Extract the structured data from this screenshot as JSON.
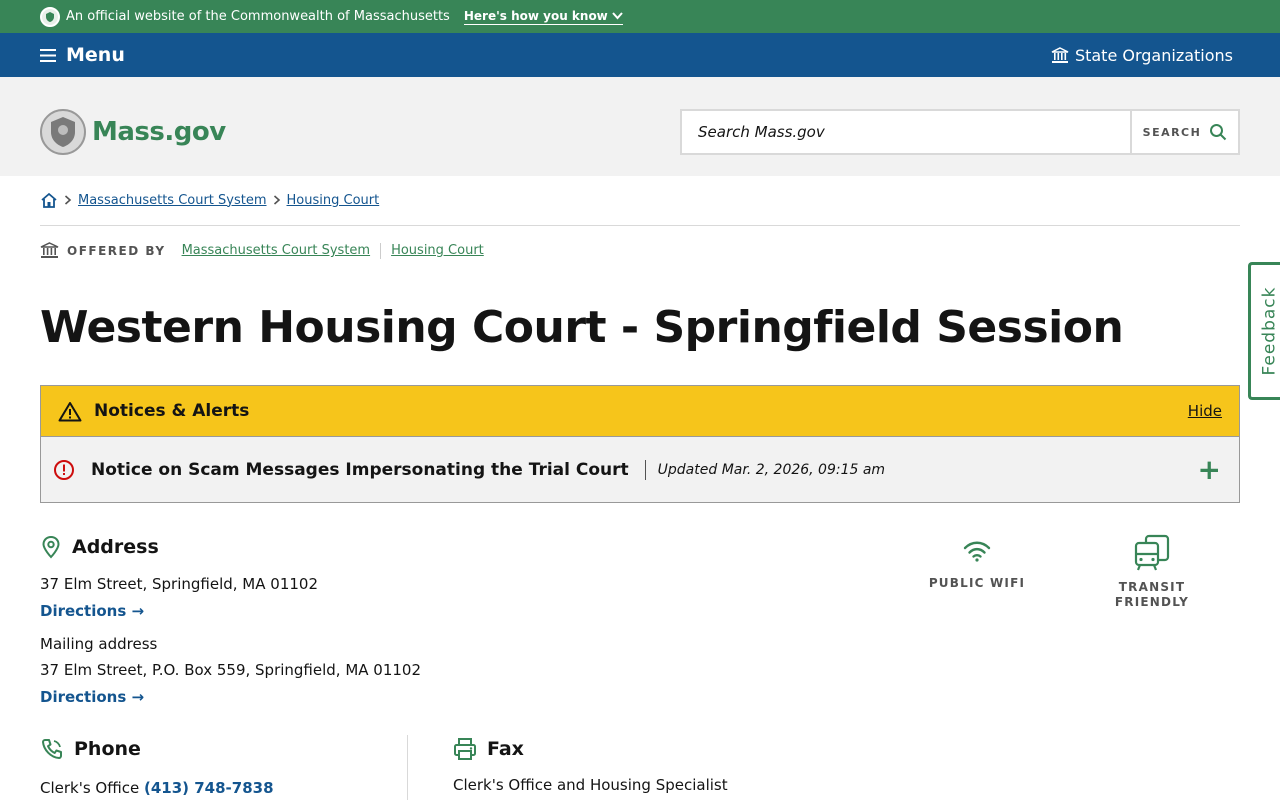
{
  "banner": {
    "text": "An official website of the Commonwealth of Massachusetts",
    "how_link": "Here's how you know"
  },
  "nav": {
    "menu_label": "Menu",
    "orgs_label": "State Organizations"
  },
  "header": {
    "logo_text": "Mass.gov",
    "search_placeholder": "Search Mass.gov",
    "search_button": "SEARCH"
  },
  "breadcrumb": {
    "items": [
      "Massachusetts Court System",
      "Housing Court"
    ]
  },
  "offered_by": {
    "label": "OFFERED BY",
    "items": [
      "Massachusetts Court System",
      "Housing Court"
    ]
  },
  "page": {
    "title": "Western Housing Court - Springfield Session"
  },
  "alerts": {
    "heading": "Notices & Alerts",
    "hide_label": "Hide",
    "items": [
      {
        "title": "Notice on Scam Messages Impersonating the Trial Court",
        "updated": "Updated Mar. 2, 2026, 09:15 am"
      }
    ]
  },
  "address": {
    "heading": "Address",
    "street": "37 Elm Street, Springfield, MA 01102",
    "directions1": "Directions →",
    "mailing_label": "Mailing address",
    "mailing": "37 Elm Street, P.O. Box 559, Springfield, MA 01102",
    "directions2": "Directions →"
  },
  "amenities": {
    "wifi": "PUBLIC WIFI",
    "transit_line1": "TRANSIT",
    "transit_line2": "FRIENDLY"
  },
  "phone": {
    "heading": "Phone",
    "label": "Clerk's Office",
    "number": "(413) 748-7838"
  },
  "fax": {
    "heading": "Fax",
    "label": "Clerk's Office and Housing Specialist"
  },
  "feedback_label": "Feedback",
  "colors": {
    "green": "#388557",
    "blue": "#14558f",
    "yellow": "#f6c51b",
    "red": "#cd0d0d"
  }
}
